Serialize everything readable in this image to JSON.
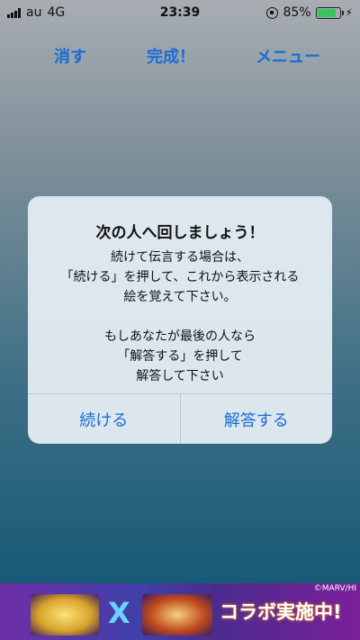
{
  "status_bar": {
    "carrier": "au",
    "network": "4G",
    "time": "23:39",
    "battery": "85%",
    "battery_level": 0.85,
    "battery_color": "#35c759"
  },
  "nav": {
    "erase_label": "消す",
    "done_label": "完成！",
    "menu_label": "メニュー"
  },
  "alert": {
    "title": "次の人へ回しましょう！",
    "message": "続けて伝言する場合は、\n「続ける」を押して、これから表示される\n絵を覚えて下さい。\n\nもしあなたが最後の人なら\n「解答する」を押して\n解答して下さい",
    "continue_label": "続ける",
    "answer_label": "解答する"
  },
  "ad": {
    "credit": "©MARV/HI",
    "cross": "X",
    "text": "コラボ実施中!"
  },
  "colors": {
    "accent": "#1a6cd6"
  }
}
